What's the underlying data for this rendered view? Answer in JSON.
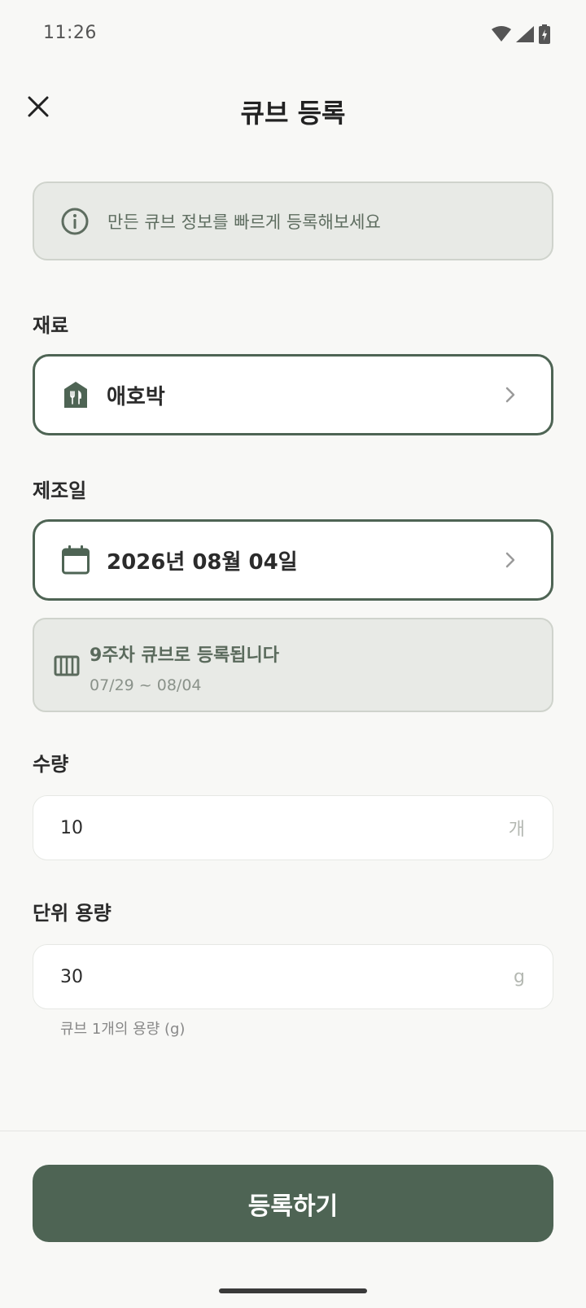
{
  "status_bar": {
    "time": "11:26",
    "icons": [
      "wifi-icon",
      "signal-icon",
      "battery-charging-icon"
    ]
  },
  "app_bar": {
    "title": "큐브 등록",
    "close_icon": "close-icon"
  },
  "info_banner": {
    "icon": "info-icon",
    "text": "만든 큐브 정보를 빠르게 등록해보세요"
  },
  "ingredient": {
    "label": "재료",
    "icon": "pantry-store-icon",
    "value": "애호박"
  },
  "production_date": {
    "label": "제조일",
    "icon": "calendar-icon",
    "value": "2026년 08월 04일"
  },
  "week_info": {
    "icon": "ice-cube-tray-icon",
    "title": "9주차 큐브로 등록됩니다",
    "range": "07/29 ~ 08/04"
  },
  "quantity": {
    "label": "수량",
    "value": "10",
    "unit": "개"
  },
  "unit_weight": {
    "label": "단위 용량",
    "value": "30",
    "unit": "g",
    "helper": "큐브 1개의 용량 (g)"
  },
  "submit": {
    "label": "등록하기"
  },
  "colors": {
    "primary": "#4e6454",
    "banner_bg": "#e8eae6",
    "background": "#f8f8f6"
  }
}
